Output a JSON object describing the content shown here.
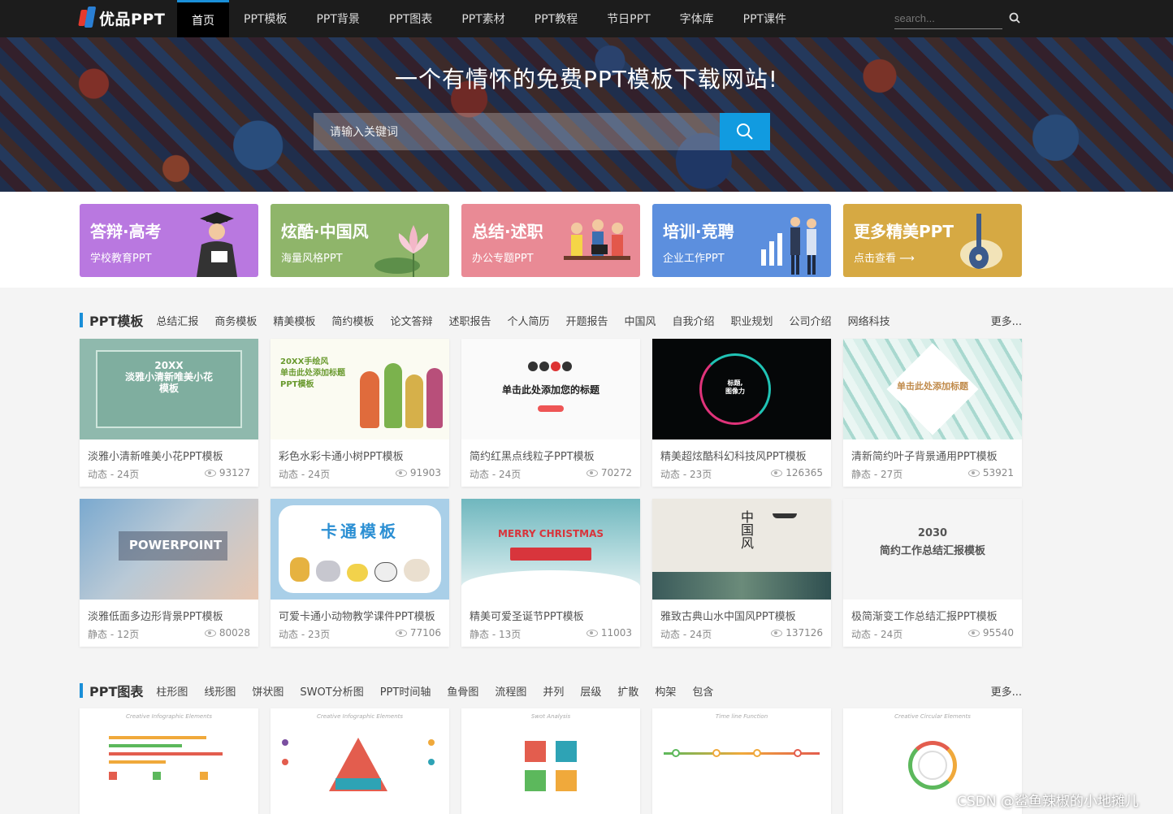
{
  "logo": {
    "text": "优品PPT"
  },
  "nav": [
    "首页",
    "PPT模板",
    "PPT背景",
    "PPT图表",
    "PPT素材",
    "PPT教程",
    "节日PPT",
    "字体库",
    "PPT课件"
  ],
  "top_search": {
    "placeholder": "search..."
  },
  "hero": {
    "title": "一个有情怀的免费PPT模板下载网站!",
    "search_placeholder": "请输入关键词"
  },
  "categories": [
    {
      "title": "答辩·高考",
      "sub": "学校教育PPT",
      "color": "#b978e0"
    },
    {
      "title": "炫酷·中国风",
      "sub": "海量风格PPT",
      "color": "#8fb56a"
    },
    {
      "title": "总结·述职",
      "sub": "办公专题PPT",
      "color": "#e98a95"
    },
    {
      "title": "培训·竞聘",
      "sub": "企业工作PPT",
      "color": "#5c8fde"
    },
    {
      "title": "更多精美PPT",
      "sub": "点击查看 ⟶",
      "color": "#d6a943"
    }
  ],
  "section1": {
    "title": "PPT模板",
    "tags": [
      "总结汇报",
      "商务模板",
      "精美模板",
      "简约模板",
      "论文答辩",
      "述职报告",
      "个人简历",
      "开题报告",
      "中国风",
      "自我介绍",
      "职业规划",
      "公司介绍",
      "网络科技"
    ],
    "more": "更多...",
    "cards": [
      {
        "name": "淡雅小清新唯美小花PPT模板",
        "meta": "动态 - 24页",
        "views": "93127",
        "thumb_text": "20XX\n淡雅小清新唯美小花\n模板"
      },
      {
        "name": "彩色水彩卡通小树PPT模板",
        "meta": "动态 - 24页",
        "views": "91903",
        "thumb_text": "20XX手绘风\n单击此处添加标题\nPPT模板"
      },
      {
        "name": "简约红黑点线粒子PPT模板",
        "meta": "动态 - 24页",
        "views": "70272",
        "thumb_text": "单击此处添加您的标题"
      },
      {
        "name": "精美超炫酷科幻科技风PPT模板",
        "meta": "动态 - 23页",
        "views": "126365",
        "thumb_text": "标题,\n图像力"
      },
      {
        "name": "清新简约叶子背景通用PPT模板",
        "meta": "静态 - 27页",
        "views": "53921",
        "thumb_text": "单击此处添加标题"
      },
      {
        "name": "淡雅低面多边形背景PPT模板",
        "meta": "静态 - 12页",
        "views": "80028",
        "thumb_text": "POWERPOINT"
      },
      {
        "name": "可爱卡通小动物教学课件PPT模板",
        "meta": "动态 - 23页",
        "views": "77106",
        "thumb_text": "卡通模板"
      },
      {
        "name": "精美可爱圣诞节PPT模板",
        "meta": "静态 - 13页",
        "views": "11003",
        "thumb_text": "MERRY CHRISTMAS"
      },
      {
        "name": "雅致古典山水中国风PPT模板",
        "meta": "动态 - 24页",
        "views": "137126",
        "thumb_text": "中国风"
      },
      {
        "name": "极简渐变工作总结汇报PPT模板",
        "meta": "动态 - 24页",
        "views": "95540",
        "thumb_text": "2030\n简约工作总结汇报模板"
      }
    ]
  },
  "section2": {
    "title": "PPT图表",
    "tags": [
      "柱形图",
      "线形图",
      "饼状图",
      "SWOT分析图",
      "PPT时间轴",
      "鱼骨图",
      "流程图",
      "并列",
      "层级",
      "扩散",
      "构架",
      "包含"
    ],
    "more": "更多...",
    "cards": [
      "Creative Infographic Elements",
      "Creative Infographic Elements",
      "Swot Analysis",
      "Time line Function",
      "Creative Circular Elements"
    ]
  },
  "watermark": "CSDN @鲨鱼辣椒的小地摊儿"
}
